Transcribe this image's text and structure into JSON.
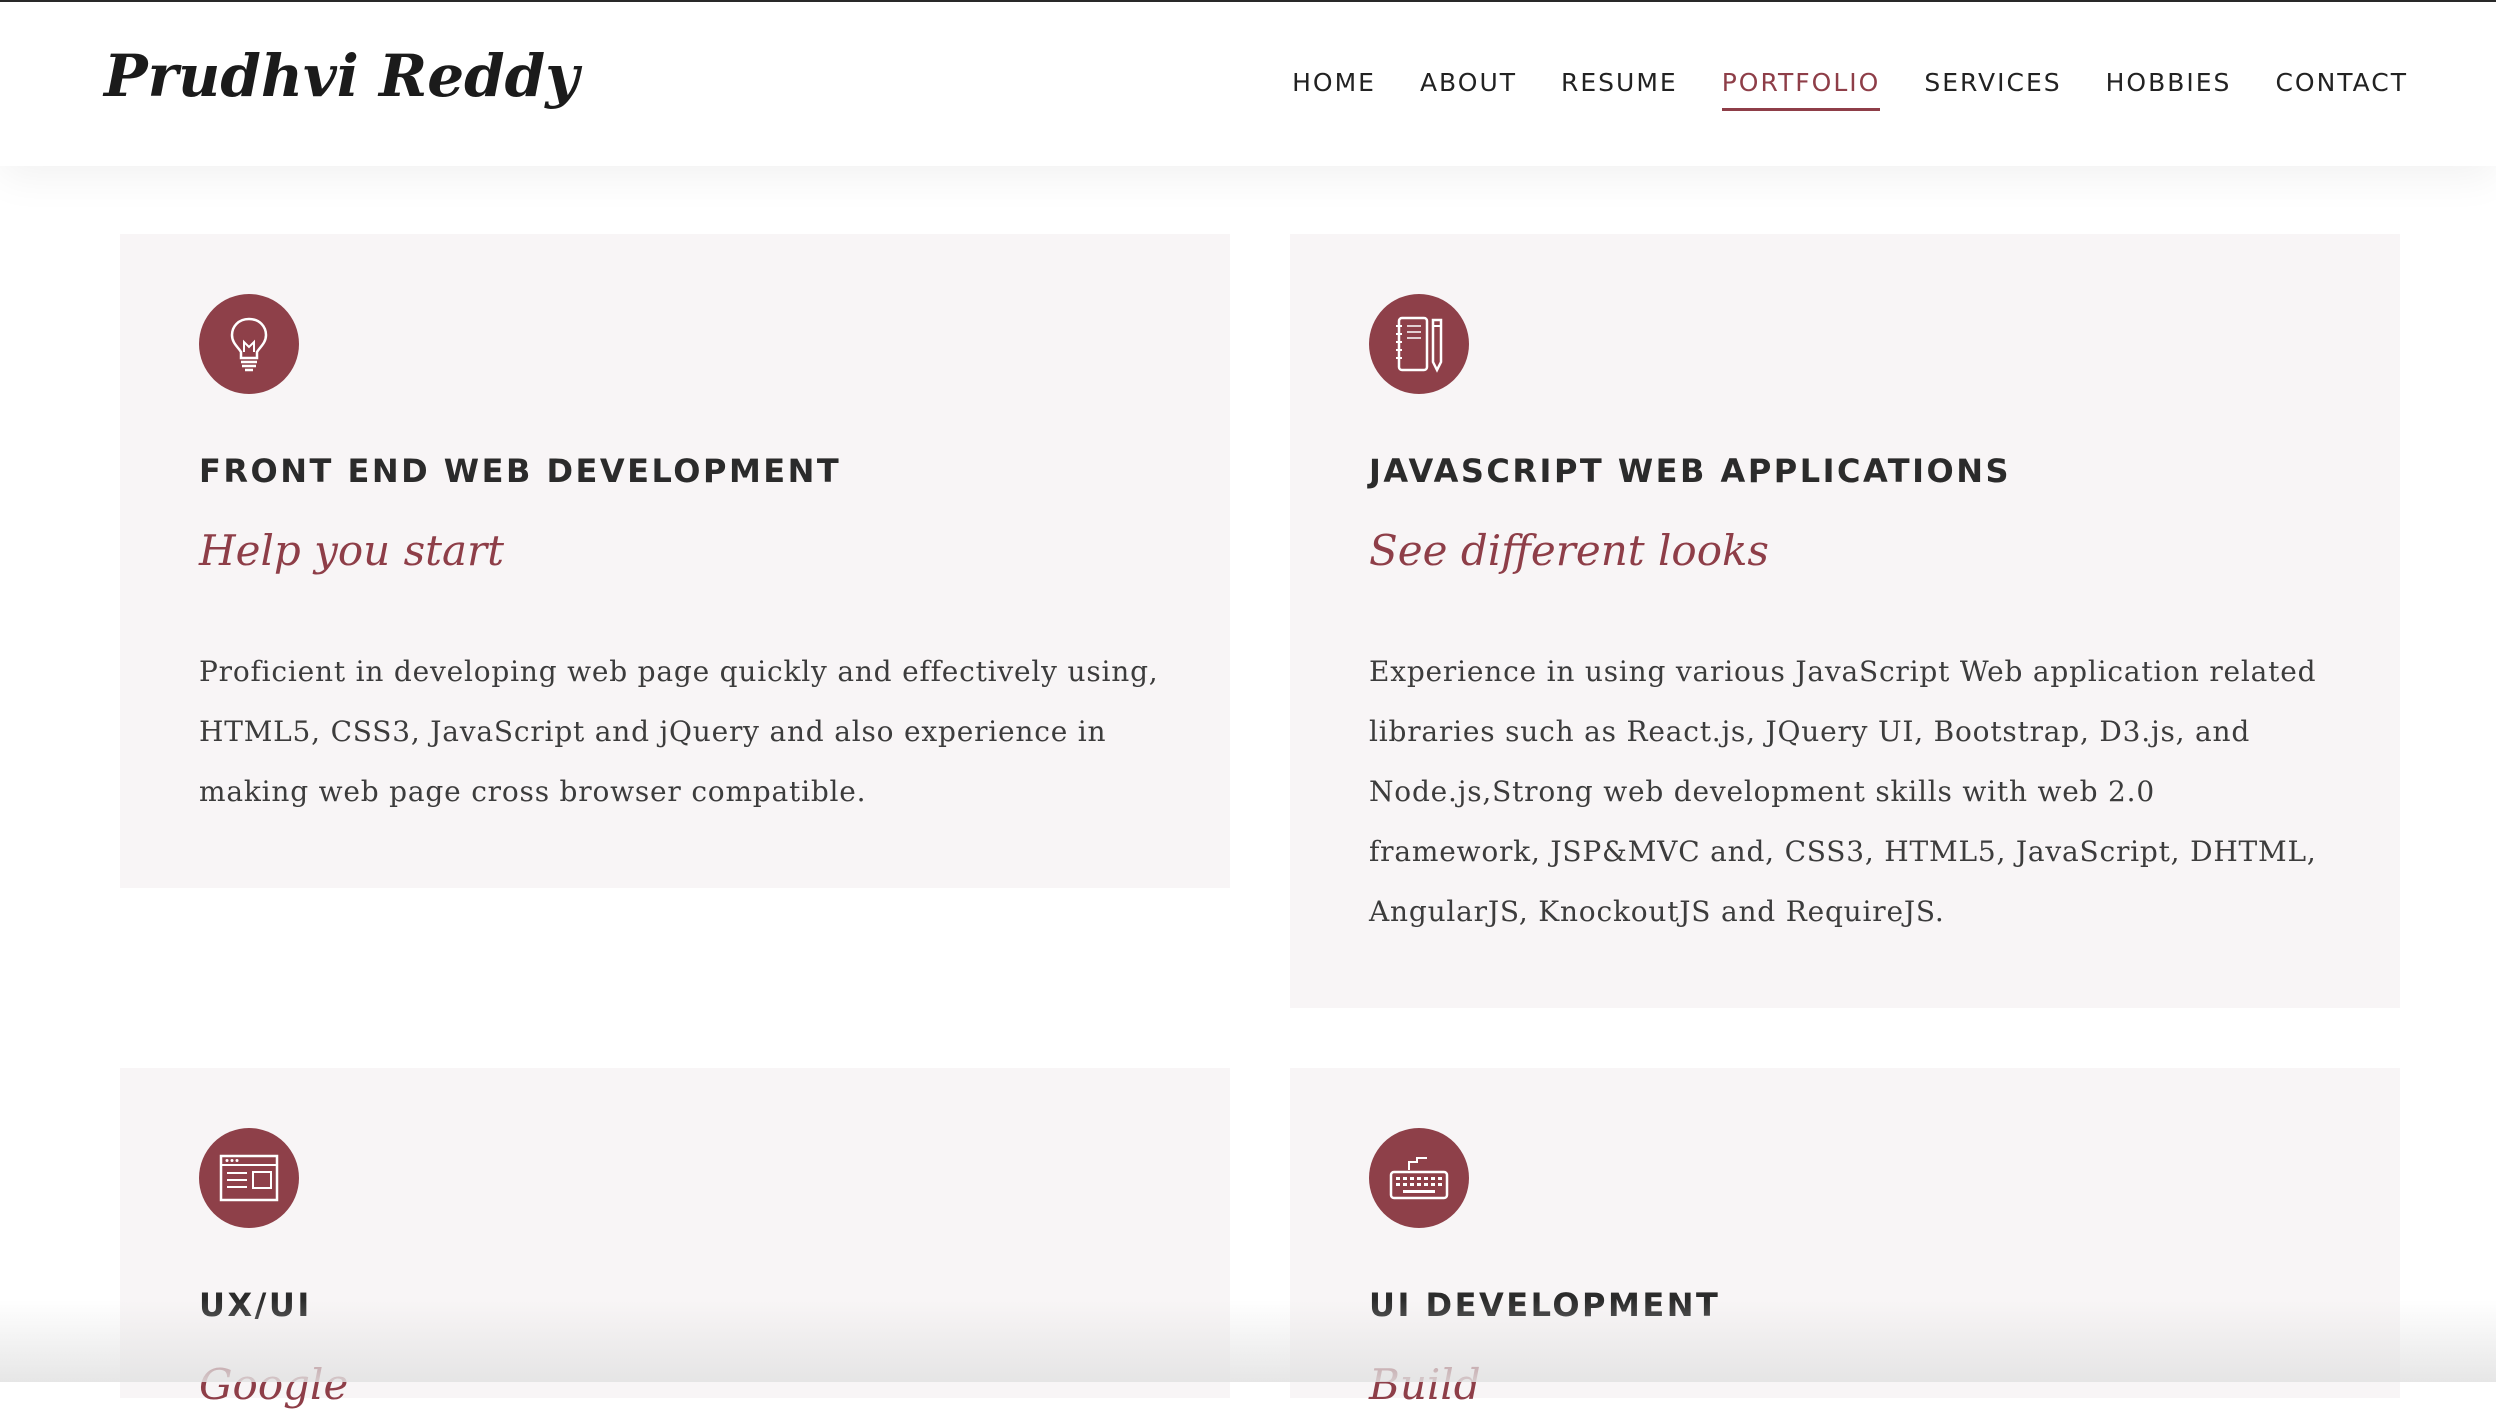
{
  "header": {
    "logo": "Prudhvi Reddy",
    "nav": [
      {
        "label": "HOME",
        "active": false
      },
      {
        "label": "ABOUT",
        "active": false
      },
      {
        "label": "RESUME",
        "active": false
      },
      {
        "label": "PORTFOLIO",
        "active": true
      },
      {
        "label": "SERVICES",
        "active": false
      },
      {
        "label": "HOBBIES",
        "active": false
      },
      {
        "label": "CONTACT",
        "active": false
      }
    ]
  },
  "colors": {
    "accent": "#8e3e48",
    "card_background": "#f8f5f6",
    "text": "#3c3c3c"
  },
  "cards": [
    {
      "icon": "lightbulb-icon",
      "title": "FRONT END WEB DEVELOPMENT",
      "subtitle": "Help you start",
      "text": "Proficient in developing web page quickly and effectively using, HTML5, CSS3, JavaScript and jQuery and also experience in making web page cross browser compatible."
    },
    {
      "icon": "notebook-pencil-icon",
      "title": "JAVASCRIPT WEB APPLICATIONS",
      "subtitle": "See different looks",
      "text": "Experience in using various JavaScript Web application related libraries such as React.js, JQuery UI, Bootstrap, D3.js, and Node.js,Strong web development skills with web 2.0 framework, JSP&MVC and, CSS3, HTML5, JavaScript, DHTML, AngularJS, KnockoutJS and RequireJS."
    },
    {
      "icon": "browser-window-icon",
      "title": "UX/UI",
      "subtitle": "Google",
      "text": ""
    },
    {
      "icon": "keyboard-icon",
      "title": "UI DEVELOPMENT",
      "subtitle": "Build",
      "text": ""
    }
  ]
}
